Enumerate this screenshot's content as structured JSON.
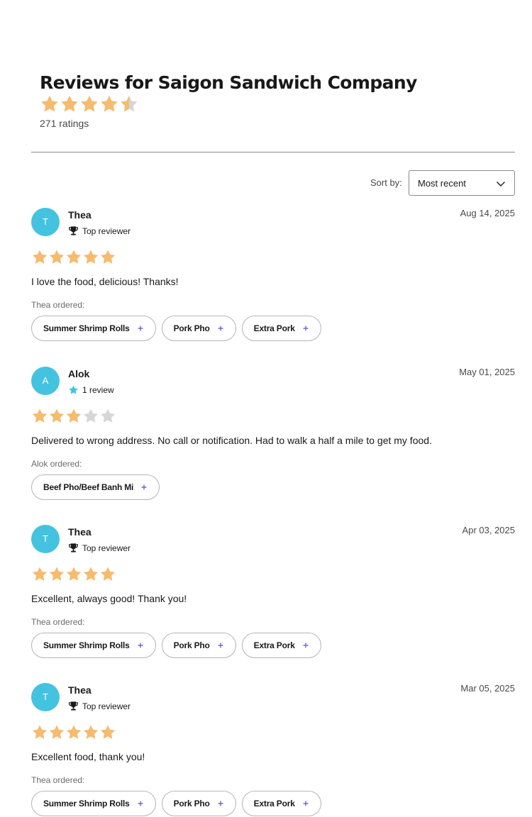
{
  "header": {
    "title": "Reviews for Saigon Sandwich Company",
    "rating": 4.5,
    "ratings_count": "271 ratings"
  },
  "colors": {
    "star_filled": "#f6bb6d",
    "star_empty": "#d6d6d6",
    "avatar": "#43c3e0",
    "plus_icon": "#5f4fc9"
  },
  "sort": {
    "label": "Sort by:",
    "value": "Most recent"
  },
  "reviews": [
    {
      "initial": "T",
      "name": "Thea",
      "badge": "Top reviewer",
      "badge_icon": "trophy-icon",
      "date": "Aug 14, 2025",
      "rating": 5,
      "text": "I love the food, delicious! Thanks!",
      "ordered_label": "Thea ordered:",
      "items": [
        "Summer Shrimp Rolls",
        "Pork Pho",
        "Extra Pork"
      ]
    },
    {
      "initial": "A",
      "name": "Alok",
      "badge": "1 review",
      "badge_icon": "star-badge-icon",
      "date": "May 01, 2025",
      "rating": 3,
      "text": "Delivered to wrong address. No call or notification. Had to walk a half a mile to get my food.",
      "ordered_label": "Alok ordered:",
      "items": [
        "Beef Pho/Beef Banh Mi"
      ]
    },
    {
      "initial": "T",
      "name": "Thea",
      "badge": "Top reviewer",
      "badge_icon": "trophy-icon",
      "date": "Apr 03, 2025",
      "rating": 5,
      "text": "Excellent, always good! Thank you!",
      "ordered_label": "Thea ordered:",
      "items": [
        "Summer Shrimp Rolls",
        "Pork Pho",
        "Extra Pork"
      ]
    },
    {
      "initial": "T",
      "name": "Thea",
      "badge": "Top reviewer",
      "badge_icon": "trophy-icon",
      "date": "Mar 05, 2025",
      "rating": 5,
      "text": "Excellent food, thank you!",
      "ordered_label": "Thea ordered:",
      "items": [
        "Summer Shrimp Rolls",
        "Pork Pho",
        "Extra Pork"
      ]
    }
  ]
}
